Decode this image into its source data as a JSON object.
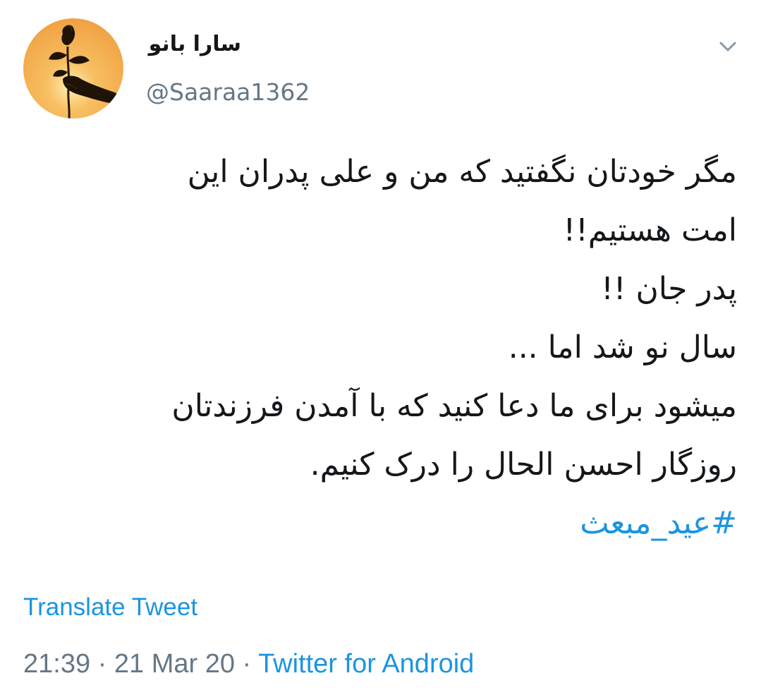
{
  "user": {
    "display_name": "سارا بانو",
    "handle": "@Saaraa1362",
    "avatar_icon": "rose-in-hand-avatar"
  },
  "menu": {
    "icon": "chevron-down-icon"
  },
  "tweet": {
    "lines": [
      "مگر خودتان نگفتید که من و علی پدران این",
      "امت هستیم!!",
      "پدر جان !!",
      "سال نو شد اما ...",
      "میشود برای ما دعا کنید که با آمدن فرزندتان",
      "روزگار احسن الحال را درک کنیم."
    ],
    "hashtag": "#عید_مبعث"
  },
  "translate_label": "Translate Tweet",
  "meta": {
    "time": "21:39",
    "separator": " · ",
    "date": "21 Mar 20",
    "source": "Twitter for Android"
  },
  "colors": {
    "link": "#1b95e0",
    "secondary_text": "#657786",
    "primary_text": "#14171a",
    "avatar_background": "#f4a94a"
  }
}
